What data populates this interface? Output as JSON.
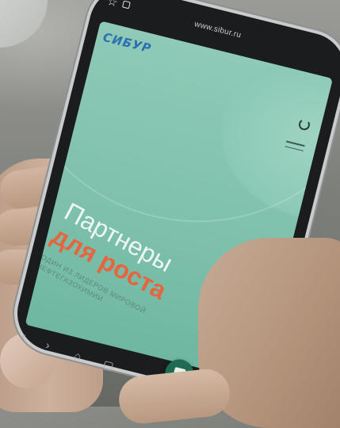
{
  "browser": {
    "url": "www.sibur.ru"
  },
  "site": {
    "logo": "СИБУР",
    "hero_line1": "Партнеры",
    "hero_line2": "для роста",
    "hero_subtitle": "ОДИН ИЗ ЛИДЕРОВ МИРОВОЙ НЕФТЕГАЗОХИМИИ"
  },
  "colors": {
    "screen_green": "#8ecab7",
    "accent_orange": "#e6643e",
    "logo_blue": "#2b6fb0",
    "chat_button": "#1f6b52"
  },
  "icons": {
    "favorite": "star-icon",
    "secure": "lock-icon",
    "reload": "refresh-icon",
    "menu": "menu-icon",
    "back": "chevron-left-icon",
    "forward": "chevron-right-icon",
    "home": "home-icon",
    "tabs": "tabs-icon",
    "chat": "chat-icon"
  }
}
